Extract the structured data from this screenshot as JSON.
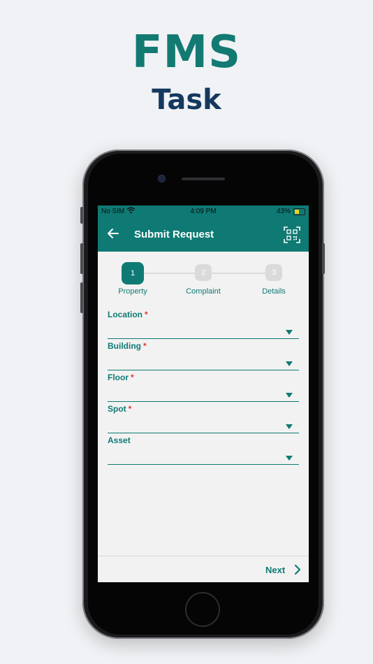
{
  "promo": {
    "title": "FMS",
    "subtitle": "Task"
  },
  "status_bar": {
    "carrier": "No SIM",
    "time": "4:09 PM",
    "battery": "43%"
  },
  "app_bar": {
    "title": "Submit Request",
    "back_icon": "back-arrow-icon",
    "action_icon": "qr-code-icon"
  },
  "stepper": {
    "current_step": 1,
    "steps": [
      {
        "number": "1",
        "label": "Property"
      },
      {
        "number": "2",
        "label": "Complaint"
      },
      {
        "number": "3",
        "label": "Details"
      }
    ]
  },
  "form": {
    "fields": [
      {
        "label": "Location",
        "required": "*",
        "value": ""
      },
      {
        "label": "Building",
        "required": "*",
        "value": ""
      },
      {
        "label": "Floor",
        "required": "*",
        "value": ""
      },
      {
        "label": "Spot",
        "required": "*",
        "value": ""
      },
      {
        "label": "Asset",
        "required": "",
        "value": ""
      }
    ]
  },
  "footer": {
    "next_label": "Next"
  },
  "colors": {
    "primary": "#0f7a74",
    "title": "#137a73",
    "subtitle": "#14395e",
    "required": "#e0392c"
  }
}
